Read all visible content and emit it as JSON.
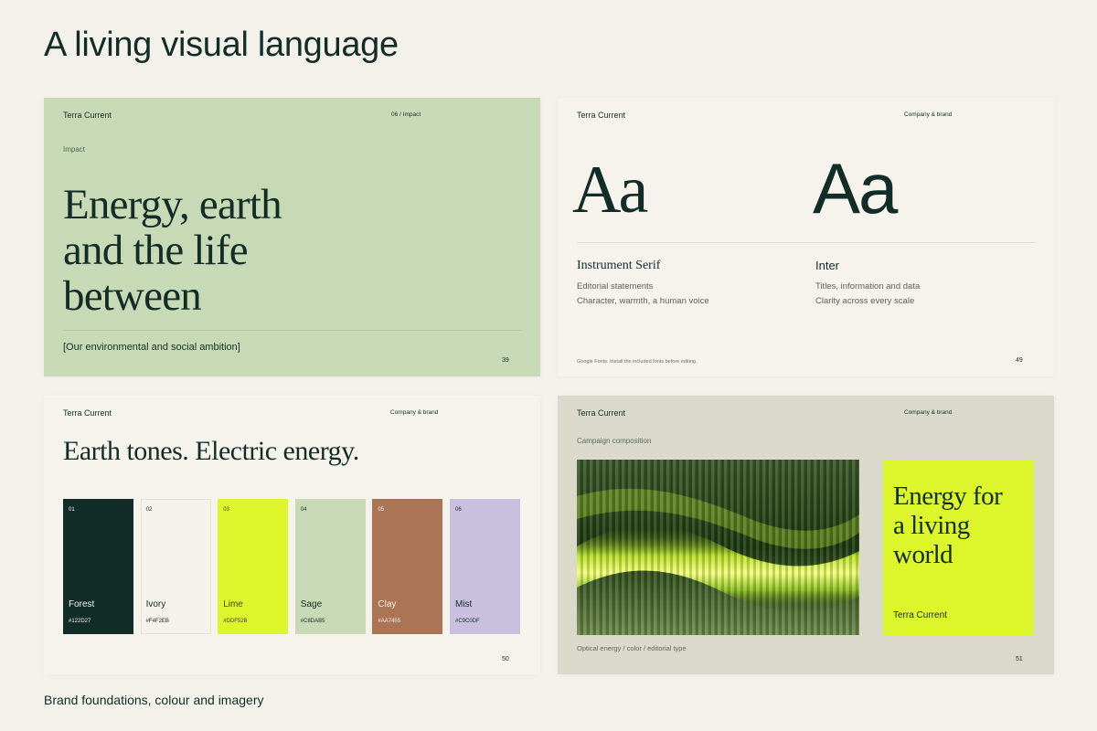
{
  "page": {
    "title": "A living visual language",
    "caption": "Brand foundations, colour and imagery"
  },
  "slides": [
    {
      "brand": "Terra Current",
      "section": "06 / Impact",
      "eyebrow": "Impact",
      "headline_lines": [
        "Energy, earth",
        "and the life",
        "between"
      ],
      "subtitle": "[Our environmental and social ambition]",
      "page_number": "39"
    },
    {
      "brand": "Terra Current",
      "section": "Company & brand",
      "fonts": [
        {
          "sample": "Aa",
          "name": "Instrument Serif",
          "lines": [
            "Editorial statements",
            "Character, warmth, a human voice"
          ]
        },
        {
          "sample": "Aa",
          "name": "Inter",
          "lines": [
            "Titles, information and data",
            "Clarity across every scale"
          ]
        }
      ],
      "note": "Google Fonts. Install the included fonts before editing.",
      "page_number": "49"
    },
    {
      "brand": "Terra Current",
      "section": "Company & brand",
      "headline": "Earth tones. Electric energy.",
      "swatches": [
        {
          "num": "01",
          "name": "Forest",
          "hex": "#122D27",
          "text_color": "#F4F2EB"
        },
        {
          "num": "02",
          "name": "Ivory",
          "hex": "#F4F2EB",
          "text_color": "#122D27"
        },
        {
          "num": "03",
          "name": "Lime",
          "hex": "#DDF52B",
          "text_color": "#3a4a12"
        },
        {
          "num": "04",
          "name": "Sage",
          "hex": "#C8DAB5",
          "text_color": "#122D27"
        },
        {
          "num": "05",
          "name": "Clay",
          "hex": "#AA7455",
          "text_color": "#F4F2EB"
        },
        {
          "num": "06",
          "name": "Mist",
          "hex": "#C9C0DF",
          "text_color": "#122D27"
        }
      ],
      "page_number": "50"
    },
    {
      "brand": "Terra Current",
      "section": "Company & brand",
      "eyebrow": "Campaign composition",
      "card_headline_lines": [
        "Energy for",
        "a living",
        "world"
      ],
      "card_brand": "Terra Current",
      "caption": "Optical energy / color / editorial type",
      "page_number": "51"
    }
  ]
}
